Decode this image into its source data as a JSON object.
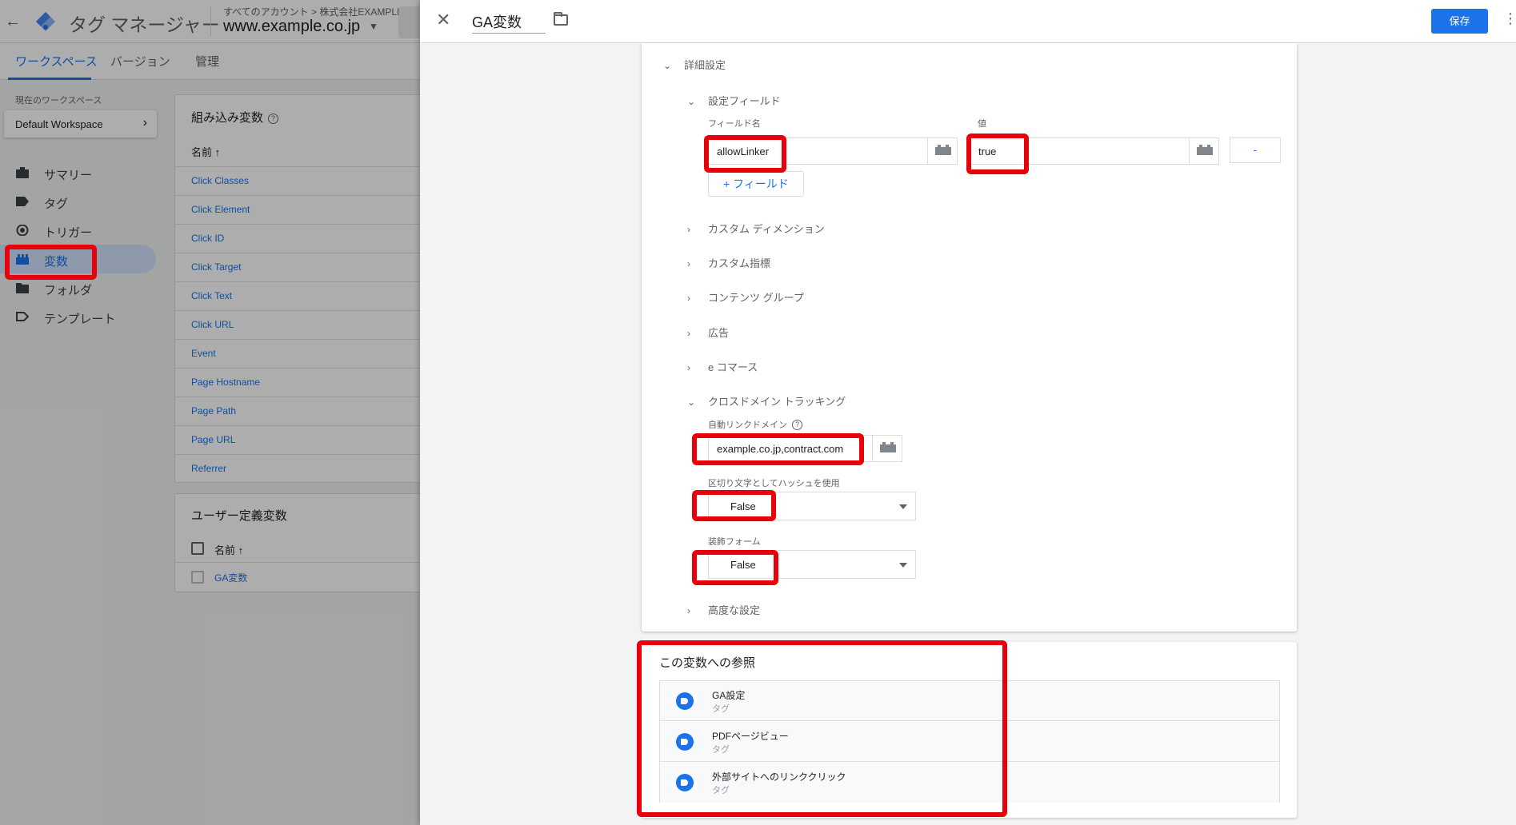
{
  "app": {
    "title": "タグ マネージャー",
    "account_crumb": "すべてのアカウント > 株式会社EXAMPLE",
    "container_name": "www.example.co.jp"
  },
  "nav_tabs": [
    {
      "label": "ワークスペース",
      "active": true
    },
    {
      "label": "バージョン",
      "active": false
    },
    {
      "label": "管理",
      "active": false
    }
  ],
  "sidebar": {
    "workspace_label": "現在のワークスペース",
    "workspace_name": "Default Workspace",
    "items": [
      {
        "label": "サマリー",
        "icon": "briefcase-icon"
      },
      {
        "label": "タグ",
        "icon": "tag-icon"
      },
      {
        "label": "トリガー",
        "icon": "trigger-icon"
      },
      {
        "label": "変数",
        "icon": "variable-icon",
        "active": true
      },
      {
        "label": "フォルダ",
        "icon": "folder-icon"
      },
      {
        "label": "テンプレート",
        "icon": "template-icon"
      }
    ]
  },
  "builtin_vars": {
    "title": "組み込み変数",
    "column_header": "名前 ↑",
    "rows": [
      "Click Classes",
      "Click Element",
      "Click ID",
      "Click Target",
      "Click Text",
      "Click URL",
      "Event",
      "Page Hostname",
      "Page Path",
      "Page URL",
      "Referrer"
    ]
  },
  "user_vars": {
    "title": "ユーザー定義変数",
    "column_header": "名前 ↑",
    "rows": [
      "GA変数"
    ]
  },
  "panel": {
    "variable_name": "GA変数",
    "save_label": "保存",
    "more_label": "⋮",
    "close_label": "✕"
  },
  "config": {
    "advanced_settings": "詳細設定",
    "fields_to_set": "設定フィールド",
    "field_name_label": "フィールド名",
    "value_label": "値",
    "field_name_value": "allowLinker",
    "field_value": "true",
    "remove_label": "-",
    "add_field_label": "+ フィールド",
    "custom_dimensions": "カスタム ディメンション",
    "custom_metrics": "カスタム指標",
    "content_groups": "コンテンツ グループ",
    "advertising": "広告",
    "ecommerce": "e コマース",
    "cross_domain": "クロスドメイン トラッキング",
    "auto_link_domains_label": "自動リンクドメイン",
    "auto_link_domains_value": "example.co.jp,contract.com",
    "use_hash_label": "区切り文字としてハッシュを使用",
    "use_hash_value": "False",
    "decorate_forms_label": "装飾フォーム",
    "decorate_forms_value": "False",
    "advanced_config": "高度な設定"
  },
  "references": {
    "title": "この変数への参照",
    "items": [
      {
        "name": "GA設定",
        "type": "タグ"
      },
      {
        "name": "PDFページビュー",
        "type": "タグ"
      },
      {
        "name": "外部サイトへのリンククリック",
        "type": "タグ"
      }
    ]
  },
  "colors": {
    "accent": "#1a73e8",
    "highlight": "#e8000b"
  }
}
